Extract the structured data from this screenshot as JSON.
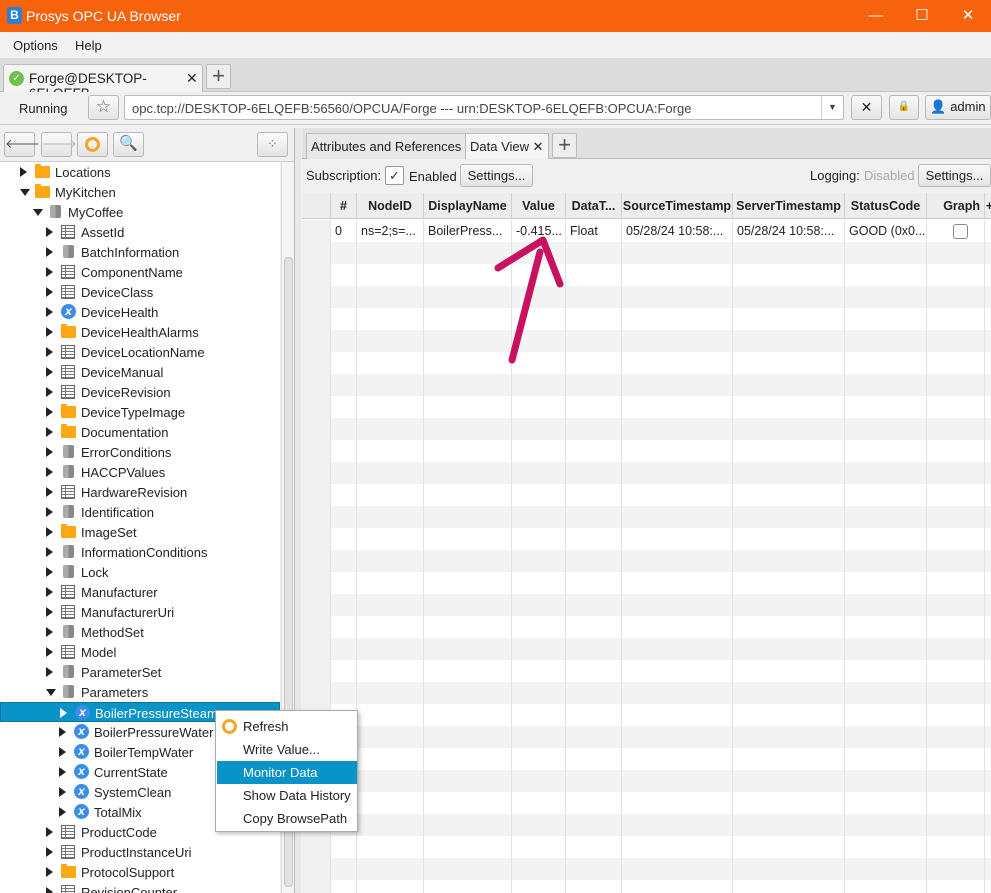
{
  "window": {
    "title": "Prosys OPC UA Browser",
    "app_icon_letter": "B",
    "controls": {
      "minimize": "—",
      "maximize": "☐",
      "close": "✕"
    }
  },
  "menu": [
    "Options",
    "Help"
  ],
  "connection_tab": {
    "label": "Forge@DESKTOP-6ELQEFB",
    "close": "✕",
    "add": "+"
  },
  "address_bar": {
    "status": "Running",
    "address": "opc.tcp://DESKTOP-6ELQEFB:56560/OPCUA/Forge --- urn:DESKTOP-6ELQEFB:OPCUA:Forge",
    "user": "admin"
  },
  "tree": [
    {
      "label": "Locations",
      "level": 0,
      "icon": "folder",
      "state": "collapsed"
    },
    {
      "label": "MyKitchen",
      "level": 0,
      "icon": "folder",
      "state": "expanded"
    },
    {
      "label": "MyCoffee",
      "level": 1,
      "icon": "object",
      "state": "expanded"
    },
    {
      "label": "AssetId",
      "level": 2,
      "icon": "property",
      "state": "collapsed"
    },
    {
      "label": "BatchInformation",
      "level": 2,
      "icon": "object",
      "state": "collapsed"
    },
    {
      "label": "ComponentName",
      "level": 2,
      "icon": "property",
      "state": "collapsed"
    },
    {
      "label": "DeviceClass",
      "level": 2,
      "icon": "property",
      "state": "collapsed"
    },
    {
      "label": "DeviceHealth",
      "level": 2,
      "icon": "variable",
      "state": "collapsed"
    },
    {
      "label": "DeviceHealthAlarms",
      "level": 2,
      "icon": "folder",
      "state": "collapsed"
    },
    {
      "label": "DeviceLocationName",
      "level": 2,
      "icon": "property",
      "state": "collapsed"
    },
    {
      "label": "DeviceManual",
      "level": 2,
      "icon": "property",
      "state": "collapsed"
    },
    {
      "label": "DeviceRevision",
      "level": 2,
      "icon": "property",
      "state": "collapsed"
    },
    {
      "label": "DeviceTypeImage",
      "level": 2,
      "icon": "folder",
      "state": "collapsed"
    },
    {
      "label": "Documentation",
      "level": 2,
      "icon": "folder",
      "state": "collapsed"
    },
    {
      "label": "ErrorConditions",
      "level": 2,
      "icon": "object",
      "state": "collapsed"
    },
    {
      "label": "HACCPValues",
      "level": 2,
      "icon": "object",
      "state": "collapsed"
    },
    {
      "label": "HardwareRevision",
      "level": 2,
      "icon": "property",
      "state": "collapsed"
    },
    {
      "label": "Identification",
      "level": 2,
      "icon": "object",
      "state": "collapsed"
    },
    {
      "label": "ImageSet",
      "level": 2,
      "icon": "folder",
      "state": "collapsed"
    },
    {
      "label": "InformationConditions",
      "level": 2,
      "icon": "object",
      "state": "collapsed"
    },
    {
      "label": "Lock",
      "level": 2,
      "icon": "object",
      "state": "collapsed"
    },
    {
      "label": "Manufacturer",
      "level": 2,
      "icon": "property",
      "state": "collapsed"
    },
    {
      "label": "ManufacturerUri",
      "level": 2,
      "icon": "property",
      "state": "collapsed"
    },
    {
      "label": "MethodSet",
      "level": 2,
      "icon": "object",
      "state": "collapsed"
    },
    {
      "label": "Model",
      "level": 2,
      "icon": "property",
      "state": "collapsed"
    },
    {
      "label": "ParameterSet",
      "level": 2,
      "icon": "object",
      "state": "collapsed"
    },
    {
      "label": "Parameters",
      "level": 2,
      "icon": "object",
      "state": "expanded"
    },
    {
      "label": "BoilerPressureSteam",
      "level": 3,
      "icon": "variable",
      "state": "collapsed",
      "selected": true
    },
    {
      "label": "BoilerPressureWater",
      "level": 3,
      "icon": "variable",
      "state": "collapsed"
    },
    {
      "label": "BoilerTempWater",
      "level": 3,
      "icon": "variable",
      "state": "collapsed"
    },
    {
      "label": "CurrentState",
      "level": 3,
      "icon": "variable",
      "state": "collapsed"
    },
    {
      "label": "SystemClean",
      "level": 3,
      "icon": "variable",
      "state": "collapsed"
    },
    {
      "label": "TotalMix",
      "level": 3,
      "icon": "variable",
      "state": "collapsed"
    },
    {
      "label": "ProductCode",
      "level": 2,
      "icon": "property",
      "state": "collapsed"
    },
    {
      "label": "ProductInstanceUri",
      "level": 2,
      "icon": "property",
      "state": "collapsed"
    },
    {
      "label": "ProtocolSupport",
      "level": 2,
      "icon": "folder",
      "state": "collapsed"
    },
    {
      "label": "RevisionCounter",
      "level": 2,
      "icon": "property",
      "state": "collapsed"
    }
  ],
  "context_menu": {
    "items": [
      "Refresh",
      "Write Value...",
      "Monitor Data",
      "Show Data History",
      "Copy BrowsePath"
    ],
    "highlighted": "Monitor Data"
  },
  "right_tabs": {
    "tabs": [
      "Attributes and References",
      "Data View"
    ],
    "active": "Data View",
    "close": "✕",
    "add": "+"
  },
  "subscription": {
    "label": "Subscription:",
    "enabled_label": "Enabled",
    "enabled": true,
    "settings": "Settings...",
    "logging_label": "Logging:",
    "logging_value": "Disabled",
    "logging_settings": "Settings..."
  },
  "table": {
    "columns": [
      "#",
      "NodeID",
      "DisplayName",
      "Value",
      "DataT...",
      "SourceTimestamp",
      "ServerTimestamp",
      "StatusCode",
      "Graph"
    ],
    "rows": [
      [
        "0",
        "ns=2;s=...",
        "BoilerPress...",
        "-0.415...",
        "Float",
        "05/28/24 10:58:...",
        "05/28/24 10:58:...",
        "GOOD (0x0..."
      ]
    ],
    "graph_checked": [
      false
    ]
  },
  "annotation": {
    "type": "arrow",
    "color": "#c8125f",
    "points_to": "Value"
  }
}
